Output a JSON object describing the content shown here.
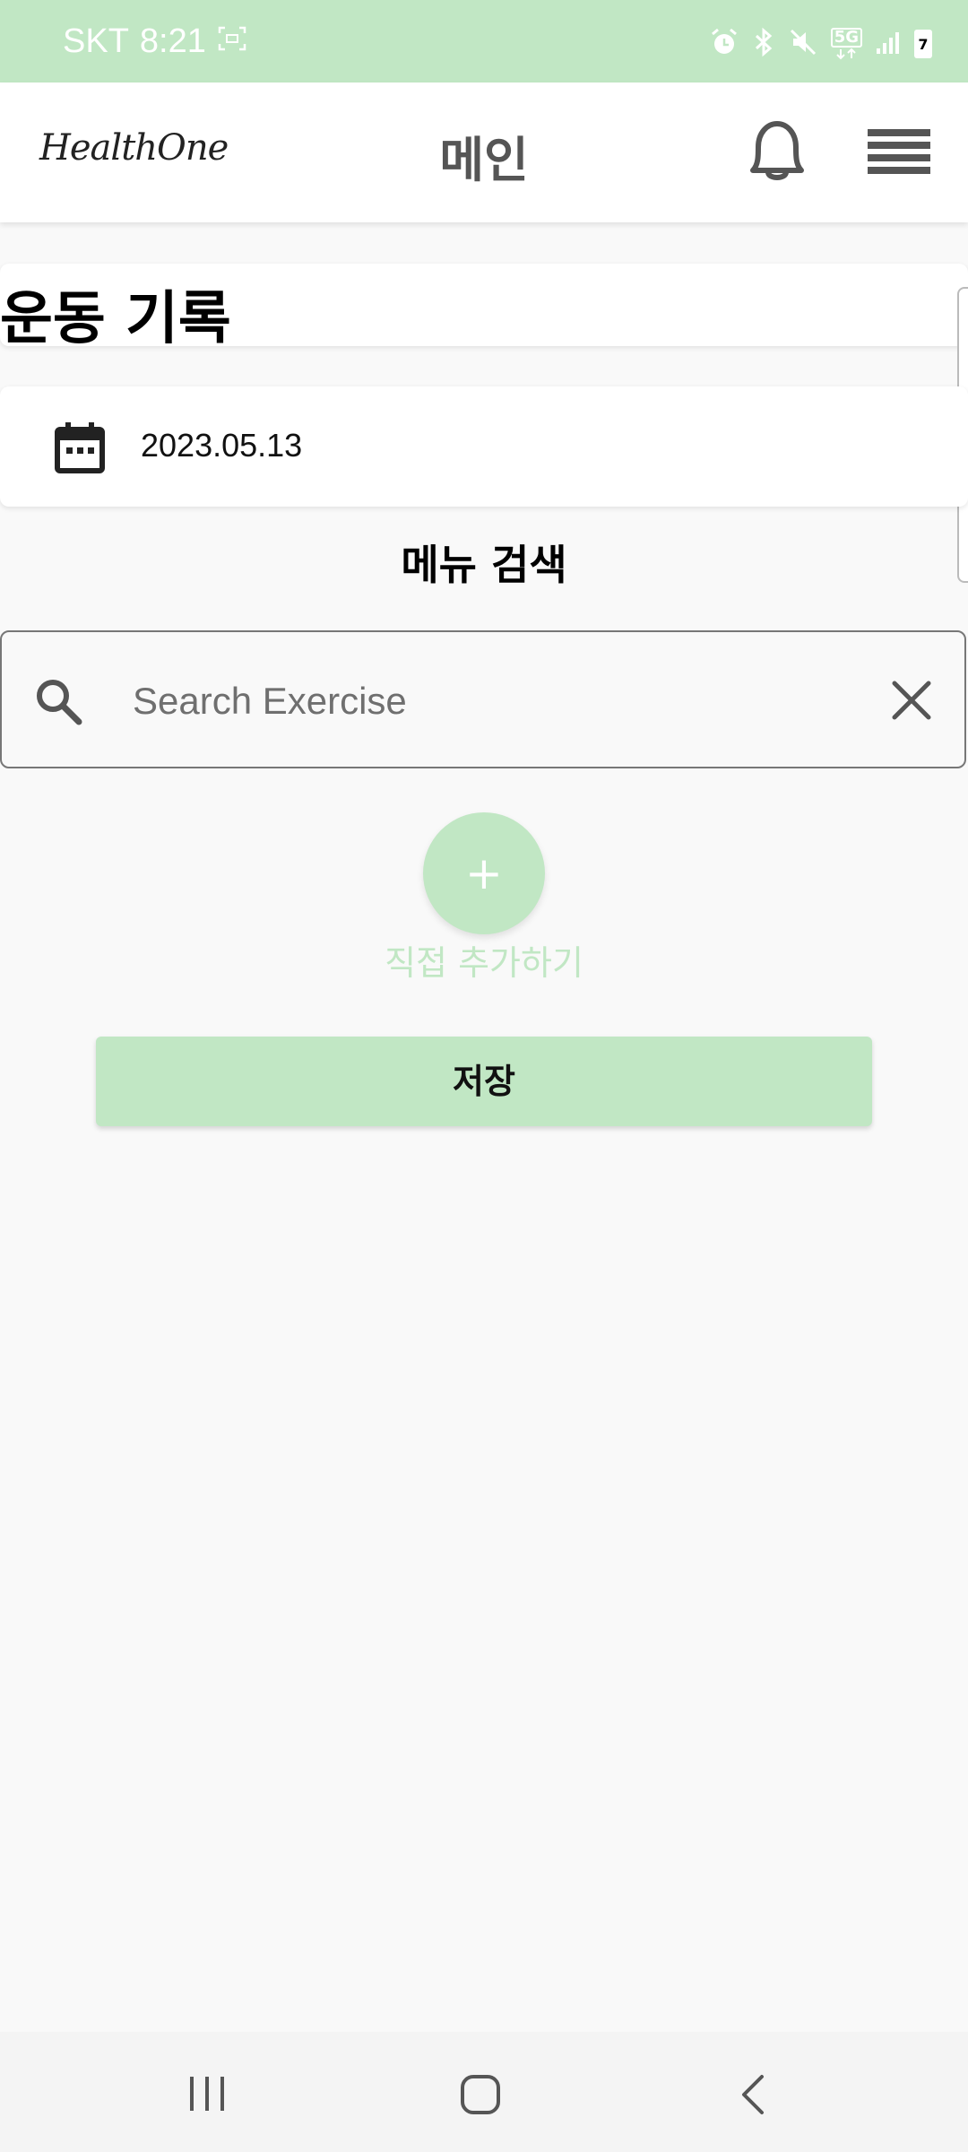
{
  "status_bar": {
    "carrier": "SKT",
    "time": "8:21",
    "network": "5G",
    "battery_level": "7"
  },
  "header": {
    "logo": "HealthOne",
    "title": "메인"
  },
  "section": {
    "title": "운동 기록"
  },
  "date_selector": {
    "date": "2023.05.13"
  },
  "search": {
    "heading": "메뉴 검색",
    "placeholder": "Search Exercise",
    "value": ""
  },
  "add_custom": {
    "icon_label": "+",
    "label": "직접 추가하기"
  },
  "save_button": {
    "label": "저장"
  },
  "colors": {
    "accent": "#c1e7c4",
    "background": "#f9f9f9"
  }
}
